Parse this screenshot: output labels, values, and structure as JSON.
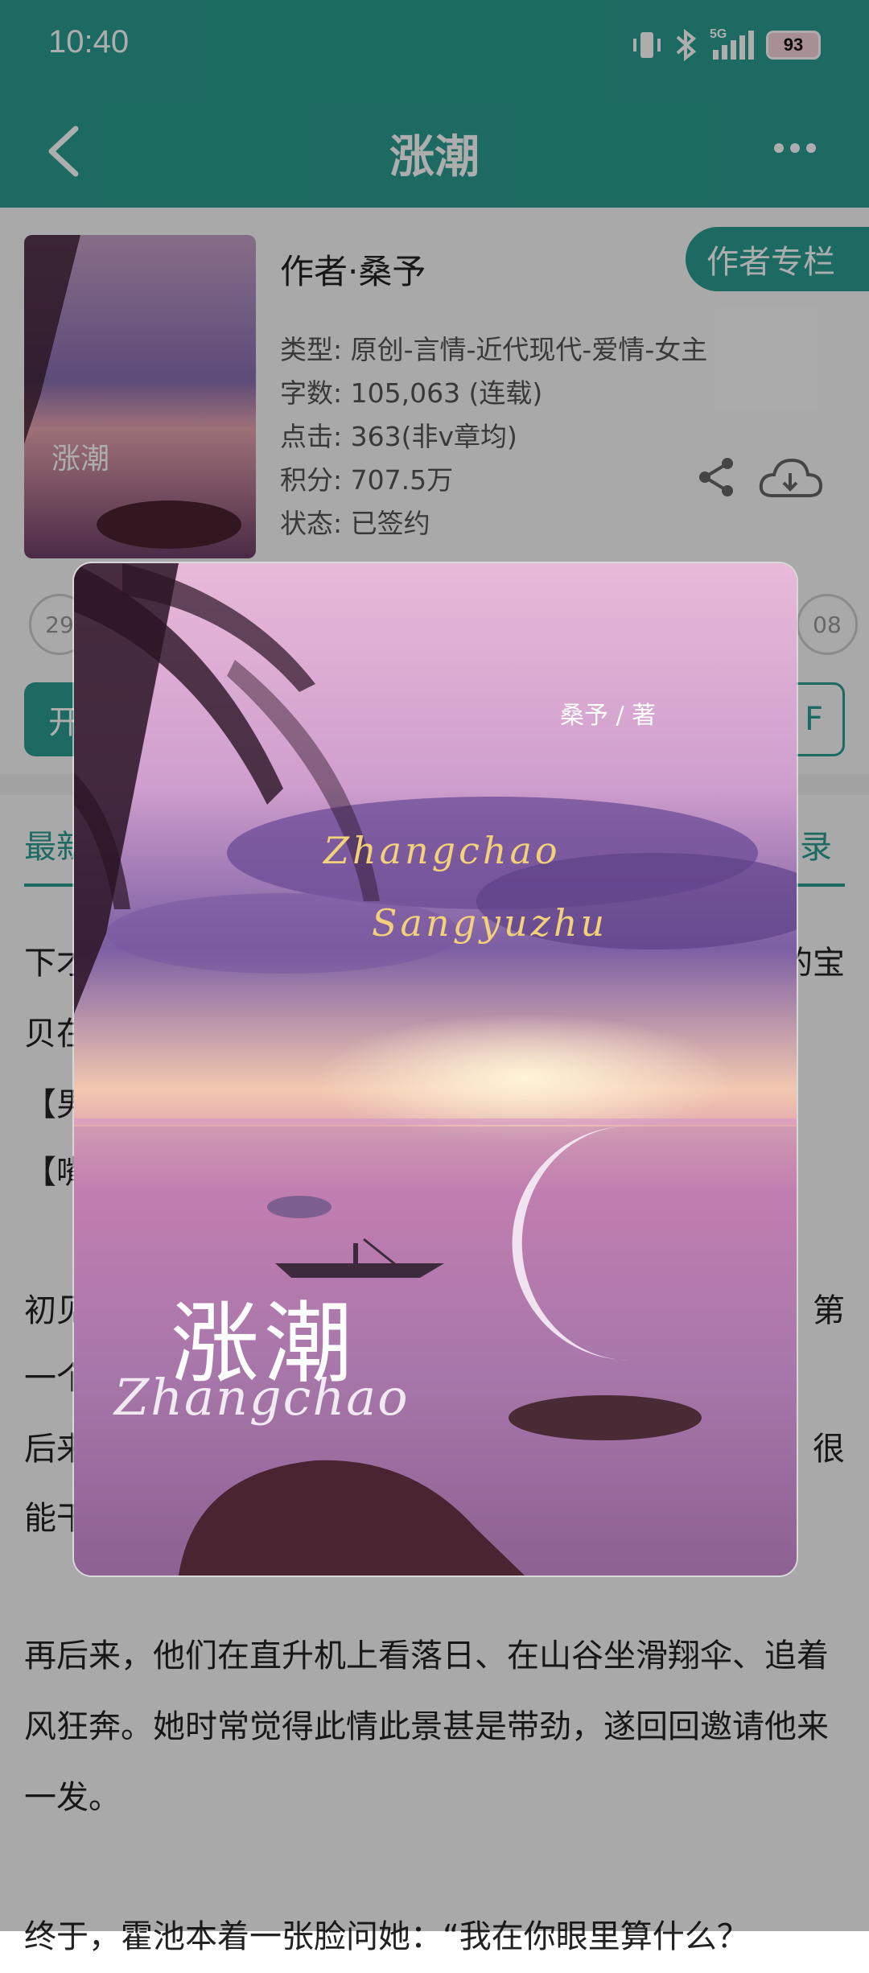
{
  "status_bar": {
    "time": "10:40",
    "network": "5G",
    "battery": "93"
  },
  "app_bar": {
    "title": "涨潮"
  },
  "book": {
    "author": "作者·桑予",
    "author_column": "作者专栏",
    "meta": [
      "类型: 原创-言情-近代现代-爱情-女主",
      "字数: 105,063 (连载)",
      "点击: 363(非v章均)",
      "积分: 707.5万",
      "状态: 已签约"
    ],
    "cover_title": "涨潮",
    "cover_author_line": "桑予 / 著",
    "cover_script_1": "Zhangchao",
    "cover_script_2": "Sangyuzhu",
    "cover_script_3": "Zhangchao"
  },
  "partial": {
    "flower_left": "29",
    "flower_right": "08",
    "read_button_char": "开",
    "right_button_char": "F",
    "tab_latest": "最新",
    "tab_catalog": "录"
  },
  "description": {
    "line1_left": "下才",
    "line1_right": "的宝",
    "line2_left": "贝在",
    "line3_left": "【男",
    "line4_left": "【嘴",
    "line5_left": "初见",
    "line5_right": "第",
    "line6_left": "一个",
    "line7_left": "后来",
    "line7_right": "很",
    "line8_left": "能干",
    "para2": "再后来，他们在直升机上看落日、在山谷坐滑翔伞、追着风狂奔。她时常觉得此情此景甚是带劲，遂回回邀请他来一发。",
    "para3": "终于，霍池本着一张脸问她：“我在你眼里算什么？"
  },
  "colors": {
    "primary": "#2a9d8f"
  }
}
